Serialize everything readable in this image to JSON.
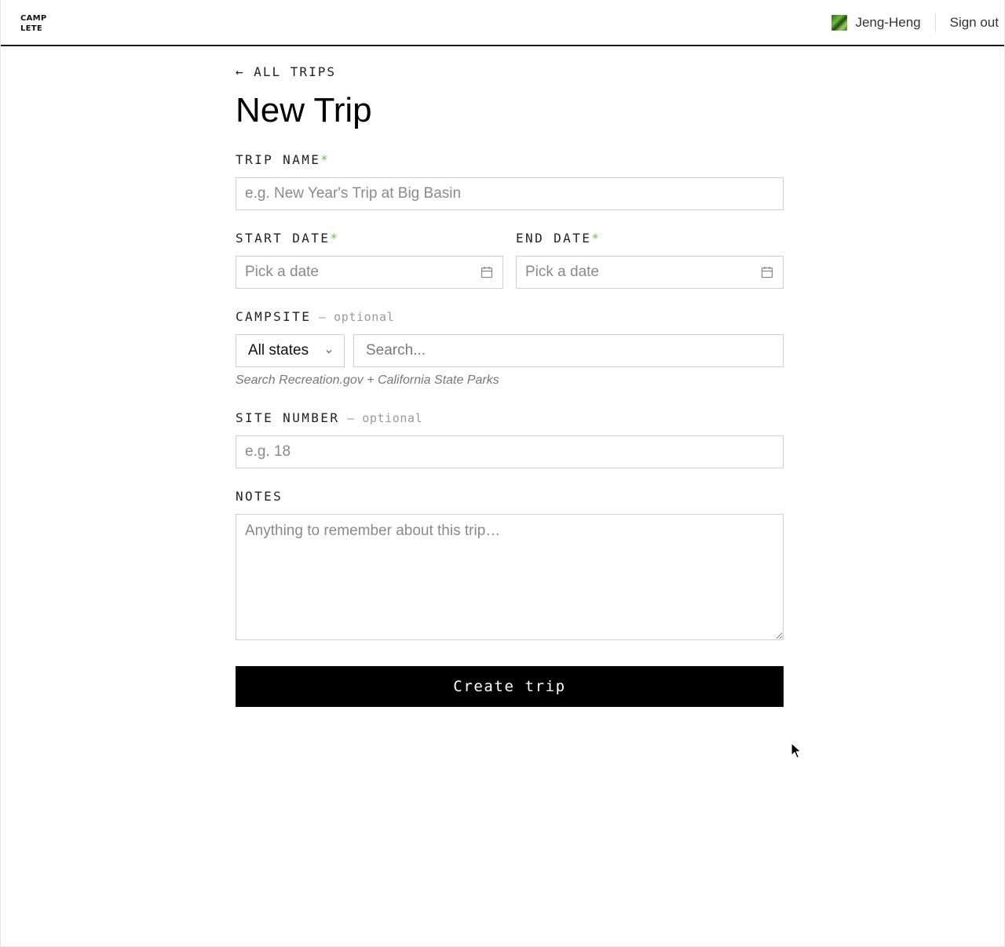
{
  "header": {
    "logo_line1": "CAMP",
    "logo_line2": "LETE",
    "user_name": "Jeng-Heng",
    "sign_out": "Sign out"
  },
  "nav": {
    "back_label": "← ALL TRIPS"
  },
  "page": {
    "title": "New Trip"
  },
  "form": {
    "trip_name": {
      "label": "TRIP NAME",
      "required_mark": "*",
      "placeholder": "e.g. New Year's Trip at Big Basin",
      "value": ""
    },
    "start_date": {
      "label": "START DATE",
      "required_mark": "*",
      "placeholder": "Pick a date"
    },
    "end_date": {
      "label": "END DATE",
      "required_mark": "*",
      "placeholder": "Pick a date"
    },
    "campsite": {
      "label": "CAMPSITE",
      "optional_note": " — optional",
      "state_select_value": "All states",
      "search_placeholder": "Search...",
      "hint": "Search Recreation.gov + California State Parks"
    },
    "site_number": {
      "label": "SITE NUMBER",
      "optional_note": " — optional",
      "placeholder": "e.g. 18",
      "value": ""
    },
    "notes": {
      "label": "NOTES",
      "placeholder": "Anything to remember about this trip…",
      "value": ""
    },
    "submit_label": "Create trip"
  },
  "icons": {
    "calendar": "calendar-icon",
    "chevron": "chevron-down-icon",
    "cursor": "mouse-pointer-icon"
  },
  "colors": {
    "accent_required": "#6cc24a",
    "button_bg": "#000000",
    "button_text": "#ffffff",
    "border": "#cfcfcf"
  }
}
